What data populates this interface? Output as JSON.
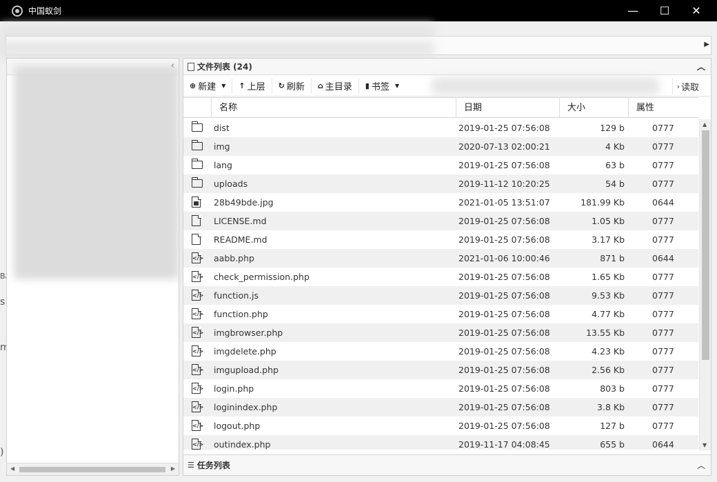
{
  "window": {
    "title": "中国蚁剑",
    "minimize": "—",
    "maximize": "☐",
    "close": "✕"
  },
  "left_panel": {
    "collapse_icon": "chevron-left-icon",
    "collapse_glyph": "‹"
  },
  "side_edge": {
    "t1": "Ba",
    "t2": "s",
    "t3": "m",
    "t4": ")"
  },
  "file_panel": {
    "header": "文件列表 (24)",
    "toolbar": {
      "new": "新建",
      "up": "上层",
      "refresh": "刷新",
      "home": "主目录",
      "bookmark": "书签",
      "read": "读取"
    },
    "columns": {
      "name": "名称",
      "date": "日期",
      "size": "大小",
      "perm": "属性"
    },
    "files": [
      {
        "name": "dist",
        "date": "2019-01-25 07:56:08",
        "size": "129 b",
        "perm": "0777",
        "type": "folder"
      },
      {
        "name": "img",
        "date": "2020-07-13 02:00:21",
        "size": "4 Kb",
        "perm": "0777",
        "type": "folder"
      },
      {
        "name": "lang",
        "date": "2019-01-25 07:56:08",
        "size": "63 b",
        "perm": "0777",
        "type": "folder"
      },
      {
        "name": "uploads",
        "date": "2019-11-12 10:20:25",
        "size": "54 b",
        "perm": "0777",
        "type": "folder"
      },
      {
        "name": "28b49bde.jpg",
        "date": "2021-01-05 13:51:07",
        "size": "181.99 Kb",
        "perm": "0644",
        "type": "image"
      },
      {
        "name": "LICENSE.md",
        "date": "2019-01-25 07:56:08",
        "size": "1.05 Kb",
        "perm": "0777",
        "type": "file"
      },
      {
        "name": "README.md",
        "date": "2019-01-25 07:56:08",
        "size": "3.17 Kb",
        "perm": "0777",
        "type": "file"
      },
      {
        "name": "aabb.php",
        "date": "2021-01-06 10:00:46",
        "size": "871 b",
        "perm": "0644",
        "type": "code"
      },
      {
        "name": "check_permission.php",
        "date": "2019-01-25 07:56:08",
        "size": "1.65 Kb",
        "perm": "0777",
        "type": "code"
      },
      {
        "name": "function.js",
        "date": "2019-01-25 07:56:08",
        "size": "9.53 Kb",
        "perm": "0777",
        "type": "code"
      },
      {
        "name": "function.php",
        "date": "2019-01-25 07:56:08",
        "size": "4.77 Kb",
        "perm": "0777",
        "type": "code"
      },
      {
        "name": "imgbrowser.php",
        "date": "2019-01-25 07:56:08",
        "size": "13.55 Kb",
        "perm": "0777",
        "type": "code"
      },
      {
        "name": "imgdelete.php",
        "date": "2019-01-25 07:56:08",
        "size": "4.23 Kb",
        "perm": "0777",
        "type": "code"
      },
      {
        "name": "imgupload.php",
        "date": "2019-01-25 07:56:08",
        "size": "2.56 Kb",
        "perm": "0777",
        "type": "code"
      },
      {
        "name": "login.php",
        "date": "2019-01-25 07:56:08",
        "size": "803 b",
        "perm": "0777",
        "type": "code"
      },
      {
        "name": "loginindex.php",
        "date": "2019-01-25 07:56:08",
        "size": "3.8 Kb",
        "perm": "0777",
        "type": "code"
      },
      {
        "name": "logout.php",
        "date": "2019-01-25 07:56:08",
        "size": "127 b",
        "perm": "0777",
        "type": "code"
      },
      {
        "name": "outindex.php",
        "date": "2019-11-17 04:08:45",
        "size": "655 b",
        "perm": "0644",
        "type": "code"
      }
    ]
  },
  "task_panel": {
    "title": "任务列表"
  }
}
